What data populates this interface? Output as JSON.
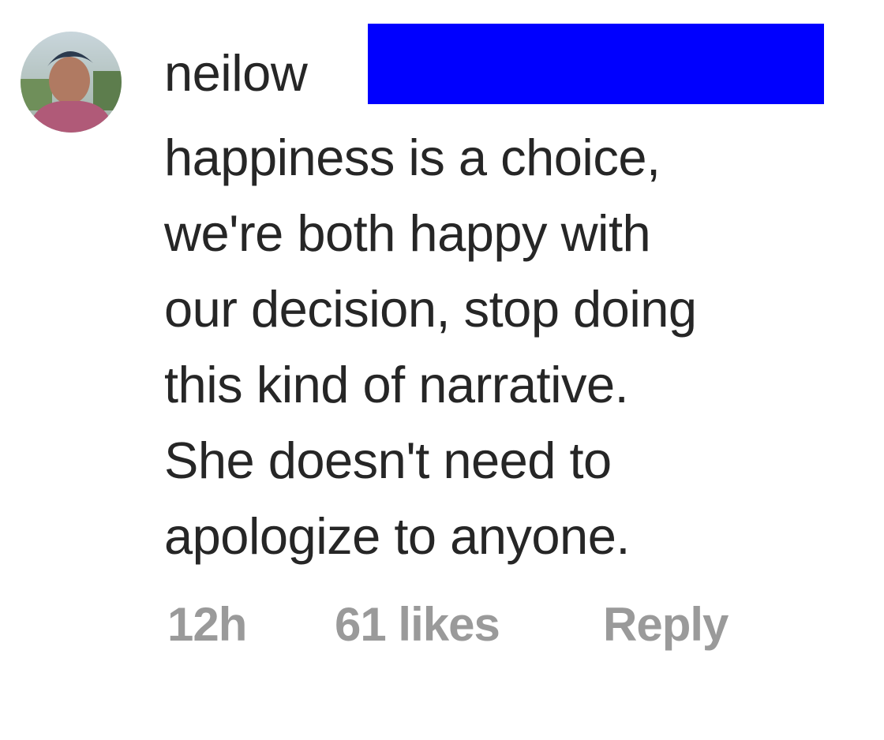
{
  "comment": {
    "avatar_icon": "user-avatar",
    "username": "neilow",
    "redaction_color": "#0000ff",
    "text_lines": [
      "happiness is a choice,",
      "we're both happy with",
      "our decision, stop doing",
      "this kind of narrative.",
      "She doesn't need to",
      "apologize to anyone."
    ],
    "timestamp": "12h",
    "likes": "61 likes",
    "reply_label": "Reply"
  }
}
